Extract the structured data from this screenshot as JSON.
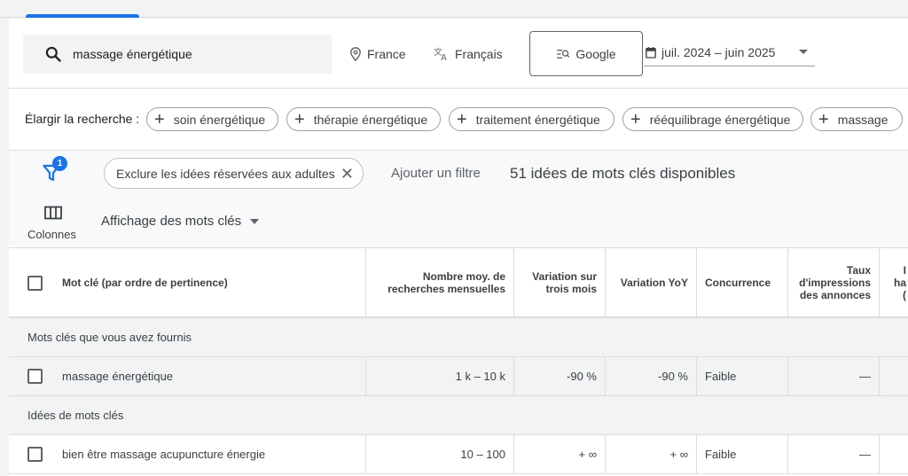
{
  "search": {
    "query": "massage énergétique"
  },
  "location": {
    "label": "France",
    "icon": "location-pin-icon"
  },
  "language": {
    "label": "Français",
    "icon": "translate-icon"
  },
  "network": {
    "label": "Google",
    "icon": "search-network-icon"
  },
  "date_range": {
    "label": "juil. 2024 – juin 2025",
    "icon": "calendar-icon"
  },
  "broaden": {
    "label": "Élargir la recherche :",
    "pills": [
      "soin énergétique",
      "thérapie énergétique",
      "traitement énergétique",
      "rééquilibrage énergétique",
      "massage"
    ]
  },
  "filters": {
    "badge_count": "1",
    "chip_label": "Exclure les idées réservées aux adultes",
    "add_filter": "Ajouter un filtre",
    "count_text": "51 idées de mots clés disponibles"
  },
  "columns": {
    "label": "Colonnes"
  },
  "view": {
    "label": "Affichage des mots clés"
  },
  "table": {
    "headers": {
      "keyword": "Mot clé (par ordre de pertinence)",
      "avg_searches_1": "Nombre moy. de",
      "avg_searches_2": "recherches mensuelles",
      "three_month_1": "Variation sur",
      "three_month_2": "trois mois",
      "yoy": "Variation YoY",
      "competition": "Concurrence",
      "impr_1": "Taux",
      "impr_2": "d'impressions",
      "impr_3": "des annonces",
      "cut_1": "I",
      "cut_2": "ha",
      "cut_3": "("
    },
    "group_provided": "Mots clés que vous avez fournis",
    "group_ideas": "Idées de mots clés",
    "provided_rows": [
      {
        "keyword": "massage énergétique",
        "avg": "1 k – 10 k",
        "three_month": "-90 %",
        "yoy": "-90 %",
        "competition": "Faible",
        "impr": "—"
      }
    ],
    "idea_rows": [
      {
        "keyword": "bien être massage acupuncture énergie",
        "avg": "10 – 100",
        "three_month": "+ ∞",
        "yoy": "+ ∞",
        "competition": "Faible",
        "impr": "—"
      }
    ]
  },
  "colors": {
    "accent": "#1a73e8",
    "panel_bg": "#ffffff",
    "page_bg": "#f1f3f4"
  }
}
